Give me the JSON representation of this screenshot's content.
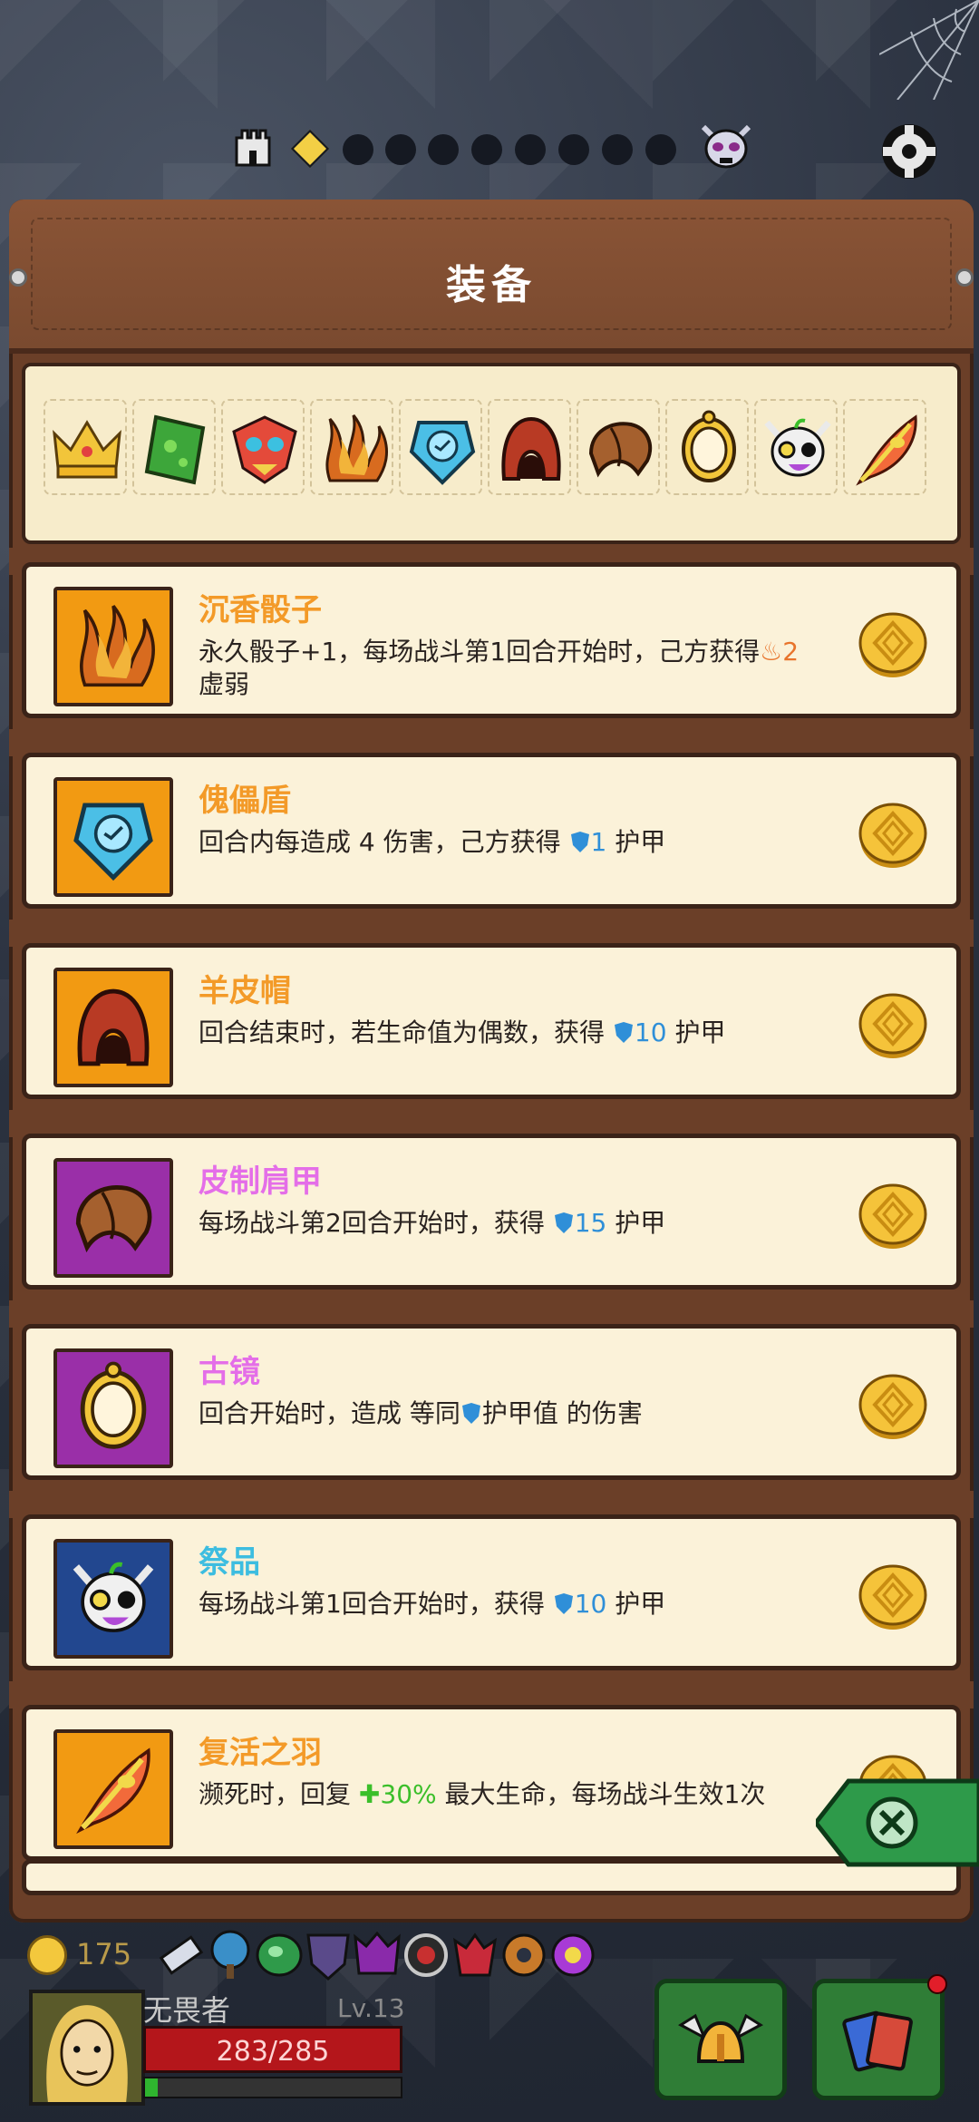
{
  "screen": {
    "title": "装备",
    "stages": {
      "current": 1,
      "total": 9
    }
  },
  "equipment_strip": {
    "icons": [
      "crown-icon",
      "green-book-icon",
      "tribal-mask-icon",
      "incense-dice-icon",
      "puppet-shield-icon",
      "sheepskin-hat-icon",
      "leather-pauldron-icon",
      "ancient-mirror-icon",
      "offering-skull-icon",
      "revival-feather-icon"
    ]
  },
  "items": [
    {
      "name": "沉香骰子",
      "rarity": "orange",
      "icon": "incense-dice-icon",
      "desc_a": "永久骰子+1，每场战斗第1回合开始时，己方获得",
      "value": "2",
      "desc_b": "虚弱"
    },
    {
      "name": "傀儡盾",
      "rarity": "orange",
      "icon": "puppet-shield-icon",
      "desc_a": "回合内每造成 4 伤害，己方获得 ",
      "value": "1",
      "desc_b": " 护甲"
    },
    {
      "name": "羊皮帽",
      "rarity": "orange",
      "icon": "sheepskin-hat-icon",
      "desc_a": "回合结束时，若生命值为偶数，获得 ",
      "value": "10",
      "desc_b": " 护甲"
    },
    {
      "name": "皮制肩甲",
      "rarity": "purple",
      "icon": "leather-pauldron-icon",
      "desc_a": "每场战斗第2回合开始时，获得 ",
      "value": "15",
      "desc_b": " 护甲"
    },
    {
      "name": "古镜",
      "rarity": "purple",
      "icon": "ancient-mirror-icon",
      "desc_a": "回合开始时，造成 等同",
      "value": "护甲值",
      "desc_b": " 的伤害"
    },
    {
      "name": "祭品",
      "rarity": "blue",
      "icon": "offering-skull-icon",
      "desc_a": "每场战斗第1回合开始时，获得 ",
      "value": "10",
      "desc_b": " 护甲"
    },
    {
      "name": "复活之羽",
      "rarity": "orange",
      "icon": "revival-feather-icon",
      "desc_a": "濒死时，回复 ",
      "value": "30%",
      "desc_b": " 最大生命，每场战斗生效1次"
    }
  ],
  "hud": {
    "gold": "175",
    "player_name": "无畏者",
    "level": "Lv.13",
    "hp": "283/285",
    "xp_fraction": 0.05
  },
  "colors": {
    "orange_rarity": "#f29a12",
    "purple_rarity": "#9a2fa8",
    "blue_rarity": "#22478f",
    "armor_blue": "#2f8fd8",
    "heal_green": "#3bbf2a",
    "weak_orange": "#e8742c"
  }
}
